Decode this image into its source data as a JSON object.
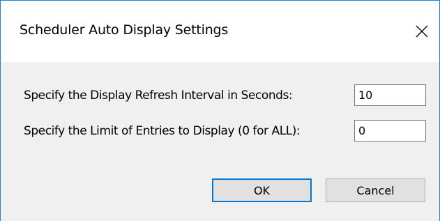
{
  "dialog": {
    "title": "Scheduler Auto Display Settings",
    "close_icon": "close-icon",
    "refresh_label": "Specify the Display Refresh Interval in Seconds:",
    "refresh_value": "10",
    "limit_label": "Specify the Limit of Entries to Display (0 for ALL):",
    "limit_value": "0",
    "ok_label": "OK",
    "cancel_label": "Cancel"
  },
  "colors": {
    "window_border": "#1883d7",
    "titlebar_bg": "#ffffff",
    "body_bg": "#f0f0f0",
    "default_button_border": "#0078d7"
  }
}
